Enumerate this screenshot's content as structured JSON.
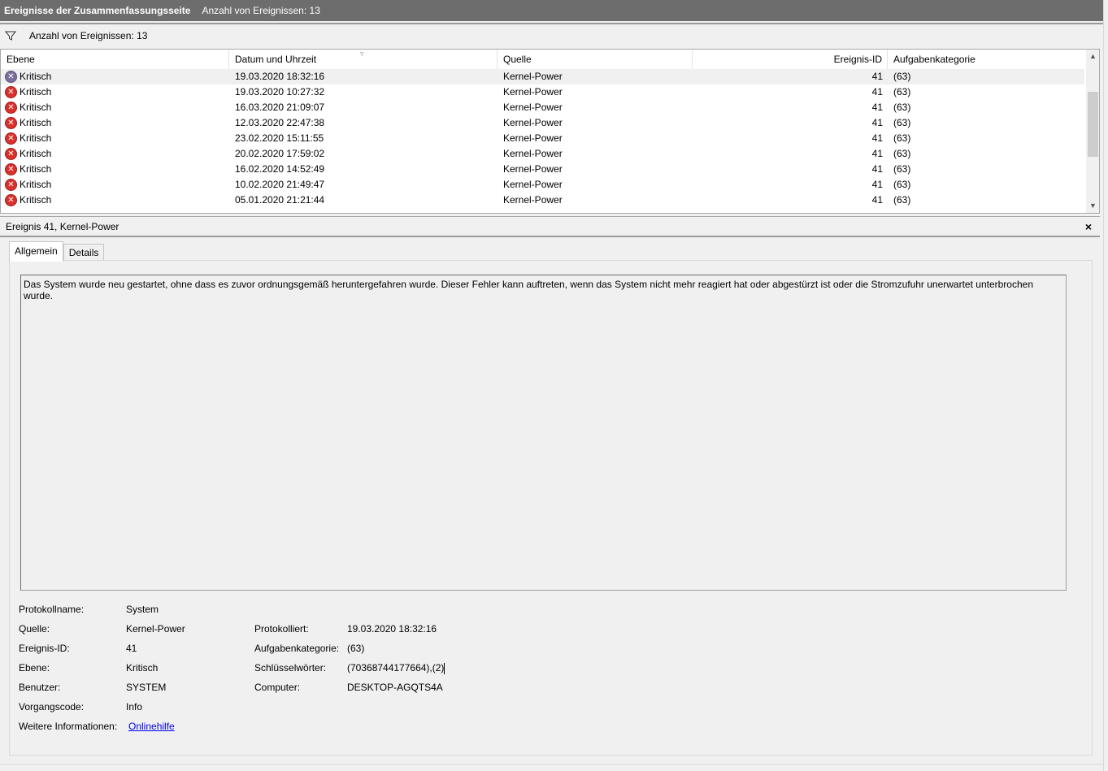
{
  "header": {
    "title": "Ereignisse der Zusammenfassungsseite",
    "count_label": "Anzahl von Ereignissen: 13"
  },
  "filter": {
    "count_label": "Anzahl von Ereignissen: 13"
  },
  "table": {
    "columns": [
      "Ebene",
      "Datum und Uhrzeit",
      "Quelle",
      "Ereignis-ID",
      "Aufgabenkategorie"
    ],
    "rows": [
      {
        "level": "Kritisch",
        "datetime": "19.03.2020 18:32:16",
        "source": "Kernel-Power",
        "id": "41",
        "category": "(63)"
      },
      {
        "level": "Kritisch",
        "datetime": "19.03.2020 10:27:32",
        "source": "Kernel-Power",
        "id": "41",
        "category": "(63)"
      },
      {
        "level": "Kritisch",
        "datetime": "16.03.2020 21:09:07",
        "source": "Kernel-Power",
        "id": "41",
        "category": "(63)"
      },
      {
        "level": "Kritisch",
        "datetime": "12.03.2020 22:47:38",
        "source": "Kernel-Power",
        "id": "41",
        "category": "(63)"
      },
      {
        "level": "Kritisch",
        "datetime": "23.02.2020 15:11:55",
        "source": "Kernel-Power",
        "id": "41",
        "category": "(63)"
      },
      {
        "level": "Kritisch",
        "datetime": "20.02.2020 17:59:02",
        "source": "Kernel-Power",
        "id": "41",
        "category": "(63)"
      },
      {
        "level": "Kritisch",
        "datetime": "16.02.2020 14:52:49",
        "source": "Kernel-Power",
        "id": "41",
        "category": "(63)"
      },
      {
        "level": "Kritisch",
        "datetime": "10.02.2020 21:49:47",
        "source": "Kernel-Power",
        "id": "41",
        "category": "(63)"
      },
      {
        "level": "Kritisch",
        "datetime": "05.01.2020 21:21:44",
        "source": "Kernel-Power",
        "id": "41",
        "category": "(63)"
      }
    ]
  },
  "detail": {
    "title": "Ereignis 41, Kernel-Power",
    "close_glyph": "×",
    "tabs": [
      "Allgemein",
      "Details"
    ],
    "description": "Das System wurde neu gestartet, ohne dass es zuvor ordnungsgemäß heruntergefahren wurde. Dieser Fehler kann auftreten, wenn das System nicht mehr reagiert hat oder abgestürzt ist oder die Stromzufuhr unerwartet unterbrochen wurde.",
    "props": {
      "log_name_label": "Protokollname:",
      "log_name": "System",
      "source_label": "Quelle:",
      "source": "Kernel-Power",
      "logged_label": "Protokolliert:",
      "logged": "19.03.2020 18:32:16",
      "event_id_label": "Ereignis-ID:",
      "event_id": "41",
      "category_label": "Aufgabenkategorie:",
      "category": "(63)",
      "level_label": "Ebene:",
      "level": "Kritisch",
      "keywords_label": "Schlüsselwörter:",
      "keywords": "(70368744177664),(2)",
      "user_label": "Benutzer:",
      "user": "SYSTEM",
      "computer_label": "Computer:",
      "computer": "DESKTOP-AGQTS4A",
      "opcode_label": "Vorgangscode:",
      "opcode": "Info",
      "more_info_label": "Weitere Informationen:",
      "more_info_link": "Onlinehilfe"
    }
  },
  "icons": {
    "filter": "filter-icon",
    "error": "error-icon",
    "sort": "sort-caret-icon",
    "close": "close-icon"
  },
  "colors": {
    "titlebar": "#6d6d6d",
    "error_red": "#d9302b",
    "link": "#0000ee"
  }
}
